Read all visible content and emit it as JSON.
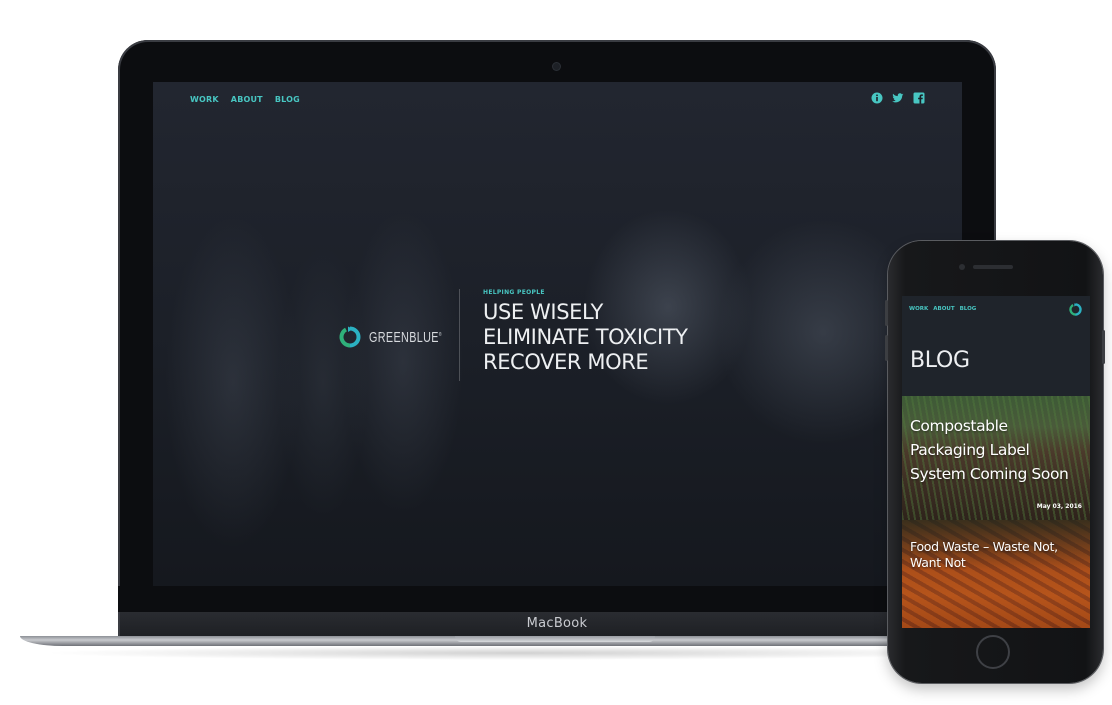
{
  "laptop": {
    "label": "MacBook",
    "site": {
      "nav": [
        {
          "label": "WORK"
        },
        {
          "label": "ABOUT"
        },
        {
          "label": "BLOG"
        }
      ],
      "social_icons": [
        "info-icon",
        "twitter-icon",
        "facebook-icon"
      ],
      "brand": {
        "name": "GREENBLUE",
        "logo_icon": "greenblue-logo-icon",
        "mark": "®"
      },
      "hero": {
        "tagline": "HELPING PEOPLE",
        "lines": [
          "USE WISELY",
          "ELIMINATE TOXICITY",
          "RECOVER MORE"
        ]
      }
    }
  },
  "phone": {
    "site": {
      "nav": [
        {
          "label": "WORK"
        },
        {
          "label": "ABOUT"
        },
        {
          "label": "BLOG"
        }
      ],
      "logo_icon": "greenblue-logo-icon",
      "page_title": "BLOG",
      "posts": [
        {
          "title": "Compostable Packaging Label System Coming Soon",
          "date": "May 03, 2016"
        },
        {
          "title": "Food Waste – Waste Not, Want Not"
        }
      ]
    }
  },
  "colors": {
    "accent": "#48c6c2",
    "logo_green": "#2fb07a",
    "logo_teal": "#2bb1c2",
    "screen_bg": "#1f242b"
  }
}
